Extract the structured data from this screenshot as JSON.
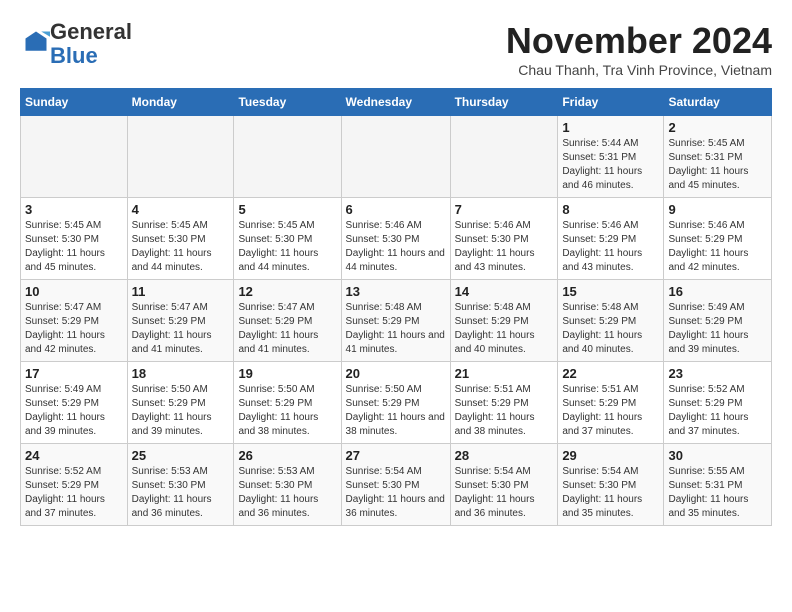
{
  "logo": {
    "general": "General",
    "blue": "Blue"
  },
  "title": "November 2024",
  "subtitle": "Chau Thanh, Tra Vinh Province, Vietnam",
  "weekdays": [
    "Sunday",
    "Monday",
    "Tuesday",
    "Wednesday",
    "Thursday",
    "Friday",
    "Saturday"
  ],
  "weeks": [
    [
      {
        "day": "",
        "info": ""
      },
      {
        "day": "",
        "info": ""
      },
      {
        "day": "",
        "info": ""
      },
      {
        "day": "",
        "info": ""
      },
      {
        "day": "",
        "info": ""
      },
      {
        "day": "1",
        "info": "Sunrise: 5:44 AM\nSunset: 5:31 PM\nDaylight: 11 hours\nand 46 minutes."
      },
      {
        "day": "2",
        "info": "Sunrise: 5:45 AM\nSunset: 5:31 PM\nDaylight: 11 hours\nand 45 minutes."
      }
    ],
    [
      {
        "day": "3",
        "info": "Sunrise: 5:45 AM\nSunset: 5:30 PM\nDaylight: 11 hours\nand 45 minutes."
      },
      {
        "day": "4",
        "info": "Sunrise: 5:45 AM\nSunset: 5:30 PM\nDaylight: 11 hours\nand 44 minutes."
      },
      {
        "day": "5",
        "info": "Sunrise: 5:45 AM\nSunset: 5:30 PM\nDaylight: 11 hours\nand 44 minutes."
      },
      {
        "day": "6",
        "info": "Sunrise: 5:46 AM\nSunset: 5:30 PM\nDaylight: 11 hours\nand 44 minutes."
      },
      {
        "day": "7",
        "info": "Sunrise: 5:46 AM\nSunset: 5:30 PM\nDaylight: 11 hours\nand 43 minutes."
      },
      {
        "day": "8",
        "info": "Sunrise: 5:46 AM\nSunset: 5:29 PM\nDaylight: 11 hours\nand 43 minutes."
      },
      {
        "day": "9",
        "info": "Sunrise: 5:46 AM\nSunset: 5:29 PM\nDaylight: 11 hours\nand 42 minutes."
      }
    ],
    [
      {
        "day": "10",
        "info": "Sunrise: 5:47 AM\nSunset: 5:29 PM\nDaylight: 11 hours\nand 42 minutes."
      },
      {
        "day": "11",
        "info": "Sunrise: 5:47 AM\nSunset: 5:29 PM\nDaylight: 11 hours\nand 41 minutes."
      },
      {
        "day": "12",
        "info": "Sunrise: 5:47 AM\nSunset: 5:29 PM\nDaylight: 11 hours\nand 41 minutes."
      },
      {
        "day": "13",
        "info": "Sunrise: 5:48 AM\nSunset: 5:29 PM\nDaylight: 11 hours\nand 41 minutes."
      },
      {
        "day": "14",
        "info": "Sunrise: 5:48 AM\nSunset: 5:29 PM\nDaylight: 11 hours\nand 40 minutes."
      },
      {
        "day": "15",
        "info": "Sunrise: 5:48 AM\nSunset: 5:29 PM\nDaylight: 11 hours\nand 40 minutes."
      },
      {
        "day": "16",
        "info": "Sunrise: 5:49 AM\nSunset: 5:29 PM\nDaylight: 11 hours\nand 39 minutes."
      }
    ],
    [
      {
        "day": "17",
        "info": "Sunrise: 5:49 AM\nSunset: 5:29 PM\nDaylight: 11 hours\nand 39 minutes."
      },
      {
        "day": "18",
        "info": "Sunrise: 5:50 AM\nSunset: 5:29 PM\nDaylight: 11 hours\nand 39 minutes."
      },
      {
        "day": "19",
        "info": "Sunrise: 5:50 AM\nSunset: 5:29 PM\nDaylight: 11 hours\nand 38 minutes."
      },
      {
        "day": "20",
        "info": "Sunrise: 5:50 AM\nSunset: 5:29 PM\nDaylight: 11 hours\nand 38 minutes."
      },
      {
        "day": "21",
        "info": "Sunrise: 5:51 AM\nSunset: 5:29 PM\nDaylight: 11 hours\nand 38 minutes."
      },
      {
        "day": "22",
        "info": "Sunrise: 5:51 AM\nSunset: 5:29 PM\nDaylight: 11 hours\nand 37 minutes."
      },
      {
        "day": "23",
        "info": "Sunrise: 5:52 AM\nSunset: 5:29 PM\nDaylight: 11 hours\nand 37 minutes."
      }
    ],
    [
      {
        "day": "24",
        "info": "Sunrise: 5:52 AM\nSunset: 5:29 PM\nDaylight: 11 hours\nand 37 minutes."
      },
      {
        "day": "25",
        "info": "Sunrise: 5:53 AM\nSunset: 5:30 PM\nDaylight: 11 hours\nand 36 minutes."
      },
      {
        "day": "26",
        "info": "Sunrise: 5:53 AM\nSunset: 5:30 PM\nDaylight: 11 hours\nand 36 minutes."
      },
      {
        "day": "27",
        "info": "Sunrise: 5:54 AM\nSunset: 5:30 PM\nDaylight: 11 hours\nand 36 minutes."
      },
      {
        "day": "28",
        "info": "Sunrise: 5:54 AM\nSunset: 5:30 PM\nDaylight: 11 hours\nand 36 minutes."
      },
      {
        "day": "29",
        "info": "Sunrise: 5:54 AM\nSunset: 5:30 PM\nDaylight: 11 hours\nand 35 minutes."
      },
      {
        "day": "30",
        "info": "Sunrise: 5:55 AM\nSunset: 5:31 PM\nDaylight: 11 hours\nand 35 minutes."
      }
    ]
  ]
}
